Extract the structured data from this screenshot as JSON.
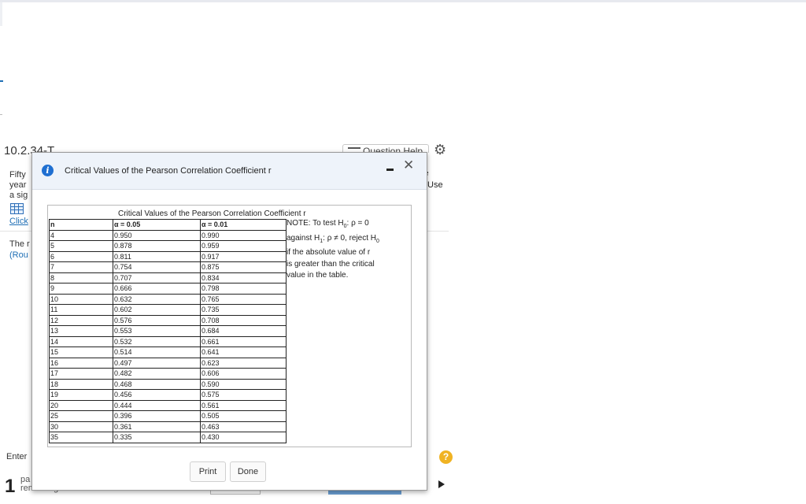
{
  "background": {
    "question_number": "10.2.34-T",
    "question_help_label": "Question Help",
    "line1": "Fifty",
    "line2": "year",
    "line3": "a sig",
    "click_link": "Click",
    "the_text": "The r",
    "round_text": "(Rou",
    "use_text": "Use",
    "e_text": "e",
    "enter_text": "Enter",
    "parts_number": "1",
    "parts_label": "pa",
    "remaining_label": "remaining",
    "help_symbol": "?"
  },
  "dialog": {
    "title": "Critical Values of the Pearson Correlation Coefficient r",
    "info_symbol": "i",
    "minimize_symbol": "–",
    "close_symbol": "✕",
    "print_label": "Print",
    "done_label": "Done",
    "table_title": "Critical Values of the Pearson Correlation Coefficient r",
    "columns": [
      "n",
      "α = 0.05",
      "α = 0.01"
    ],
    "rows": [
      [
        "4",
        "0.950",
        "0.990"
      ],
      [
        "5",
        "0.878",
        "0.959"
      ],
      [
        "6",
        "0.811",
        "0.917"
      ],
      [
        "7",
        "0.754",
        "0.875"
      ],
      [
        "8",
        "0.707",
        "0.834"
      ],
      [
        "9",
        "0.666",
        "0.798"
      ],
      [
        "10",
        "0.632",
        "0.765"
      ],
      [
        "11",
        "0.602",
        "0.735"
      ],
      [
        "12",
        "0.576",
        "0.708"
      ],
      [
        "13",
        "0.553",
        "0.684"
      ],
      [
        "14",
        "0.532",
        "0.661"
      ],
      [
        "15",
        "0.514",
        "0.641"
      ],
      [
        "16",
        "0.497",
        "0.623"
      ],
      [
        "17",
        "0.482",
        "0.606"
      ],
      [
        "18",
        "0.468",
        "0.590"
      ],
      [
        "19",
        "0.456",
        "0.575"
      ],
      [
        "20",
        "0.444",
        "0.561"
      ],
      [
        "25",
        "0.396",
        "0.505"
      ],
      [
        "30",
        "0.361",
        "0.463"
      ],
      [
        "35",
        "0.335",
        "0.430"
      ]
    ],
    "note": {
      "line1": "NOTE: To test H",
      "line1_sub": "0",
      "line1_end": ": ρ = 0",
      "line2": "against H",
      "line2_sub": "1",
      "line2_mid": ": ρ ≠ 0, reject H",
      "line2_sub2": "0",
      "line3": " if the absolute value of r",
      "line4": "is greater than the critical",
      "line5": "value in the table."
    }
  }
}
